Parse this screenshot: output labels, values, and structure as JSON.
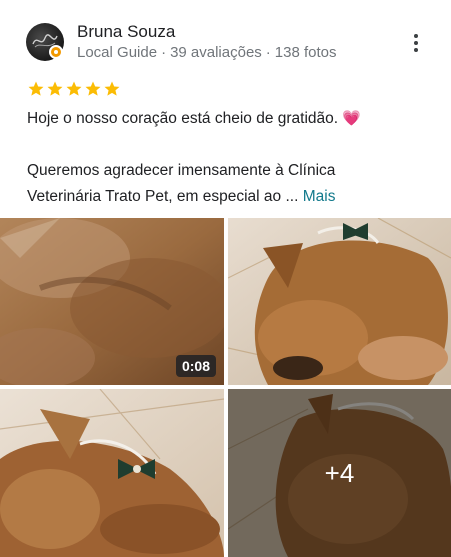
{
  "reviewer": {
    "name": "Bruna Souza",
    "label": "Local Guide",
    "reviews": "39 avaliações",
    "photos": "138 fotos",
    "separator": "·"
  },
  "rating": {
    "stars": 5,
    "max": 5,
    "color": "#fbbc04"
  },
  "review": {
    "line1": "Hoje o nosso coração está cheio de gratidão.",
    "emoji": "💗",
    "line2": "Queremos agradecer imensamente à Clínica",
    "line3": "Veterinária Trato Pet, em especial ao ...",
    "more_label": "Mais"
  },
  "media": {
    "video_duration": "0:08",
    "more_count": "+4"
  },
  "icons": [
    "more-vert-icon",
    "star-icon",
    "local-guide-badge-icon"
  ]
}
